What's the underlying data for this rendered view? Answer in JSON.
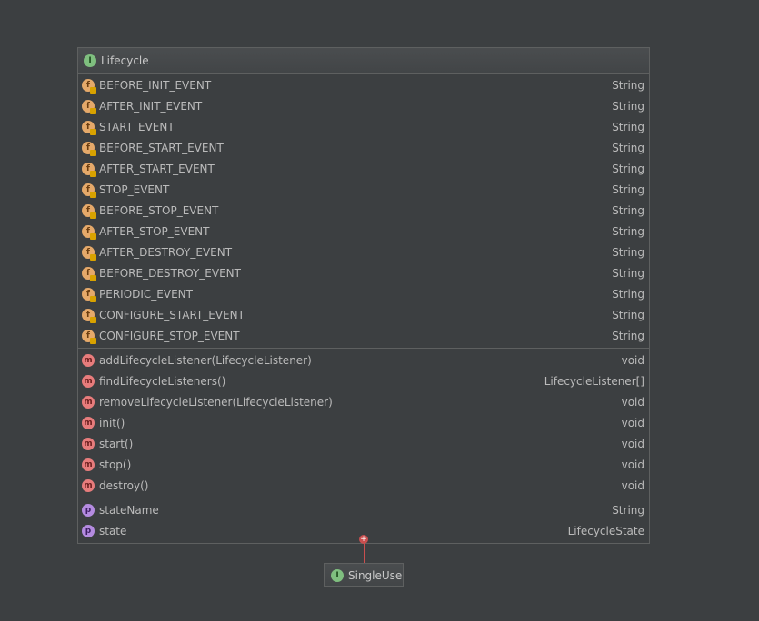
{
  "interface": {
    "name": "Lifecycle",
    "fields": [
      {
        "name": "BEFORE_INIT_EVENT",
        "type": "String"
      },
      {
        "name": "AFTER_INIT_EVENT",
        "type": "String"
      },
      {
        "name": "START_EVENT",
        "type": "String"
      },
      {
        "name": "BEFORE_START_EVENT",
        "type": "String"
      },
      {
        "name": "AFTER_START_EVENT",
        "type": "String"
      },
      {
        "name": "STOP_EVENT",
        "type": "String"
      },
      {
        "name": "BEFORE_STOP_EVENT",
        "type": "String"
      },
      {
        "name": "AFTER_STOP_EVENT",
        "type": "String"
      },
      {
        "name": "AFTER_DESTROY_EVENT",
        "type": "String"
      },
      {
        "name": "BEFORE_DESTROY_EVENT",
        "type": "String"
      },
      {
        "name": "PERIODIC_EVENT",
        "type": "String"
      },
      {
        "name": "CONFIGURE_START_EVENT",
        "type": "String"
      },
      {
        "name": "CONFIGURE_STOP_EVENT",
        "type": "String"
      }
    ],
    "methods": [
      {
        "name": "addLifecycleListener(LifecycleListener)",
        "type": "void"
      },
      {
        "name": "findLifecycleListeners()",
        "type": "LifecycleListener[]"
      },
      {
        "name": "removeLifecycleListener(LifecycleListener)",
        "type": "void"
      },
      {
        "name": "init()",
        "type": "void"
      },
      {
        "name": "start()",
        "type": "void"
      },
      {
        "name": "stop()",
        "type": "void"
      },
      {
        "name": "destroy()",
        "type": "void"
      }
    ],
    "properties": [
      {
        "name": "stateName",
        "type": "String"
      },
      {
        "name": "state",
        "type": "LifecycleState"
      }
    ]
  },
  "subclass": {
    "name": "SingleUse"
  },
  "icons": {
    "interface": "interface-icon",
    "field": "static-final-field-icon",
    "method": "method-icon",
    "property": "property-icon",
    "connector": "inheritance-connector-icon"
  },
  "colors": {
    "background": "#3c3f41",
    "border": "#5e6060",
    "interface_icon": "#7fbf7f",
    "field_icon": "#e5a96a",
    "method_icon": "#e77c7c",
    "property_icon": "#b48be0",
    "connector": "#c94f4f"
  }
}
